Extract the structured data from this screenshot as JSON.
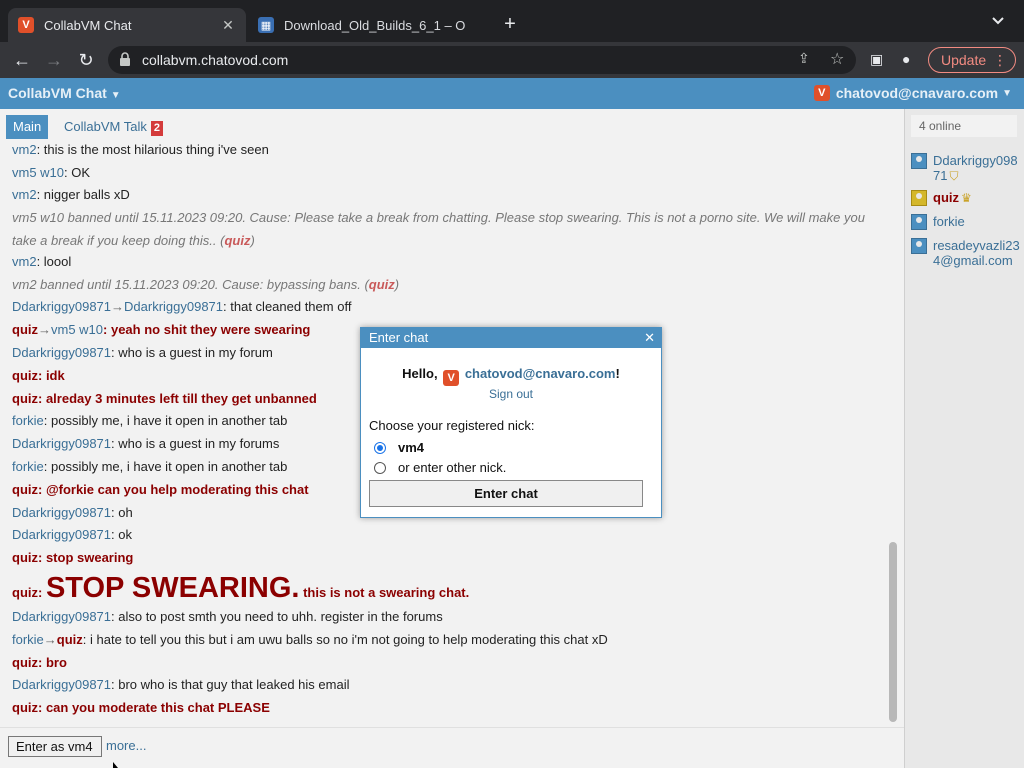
{
  "browser": {
    "tabs": [
      {
        "title": "CollabVM Chat",
        "favicon": "v-logo-icon"
      },
      {
        "title": "Download_Old_Builds_6_1 – O",
        "favicon": "document-icon"
      }
    ],
    "url": "collabvm.chatovod.com",
    "update_label": "Update"
  },
  "app": {
    "title": "CollabVM Chat",
    "user": "chatovod@cnavaro.com"
  },
  "chat_tabs": {
    "main": "Main",
    "talk": "CollabVM Talk",
    "talk_badge": "2"
  },
  "messages": [
    {
      "nick": "vm2",
      "text": ": this is the most hilarious thing i've seen"
    },
    {
      "nick": "vm5 w10",
      "text": ": OK"
    },
    {
      "nick": "vm2",
      "text": ": nigger balls xD"
    },
    {
      "text1": "vm5 w10 banned until 15.11.2023 09:20. Cause: Please take a break from chatting. Please stop swearing. This is not a porno site. We will make you take a break if you keep doing this.. (",
      "by": "quiz",
      "close": ")"
    },
    {
      "nick": "vm2",
      "text": ": loool"
    },
    {
      "text1": "vm2 banned until 15.11.2023 09:20. Cause: bypassing bans. (",
      "by": "quiz",
      "close": ")"
    },
    {
      "nick": "Ddarkriggy09871",
      "arrow": "→",
      "to": "Ddarkriggy09871",
      "text": ": that cleaned them off"
    },
    {
      "nick": "quiz",
      "arrow": "→",
      "to": "vm5 w10",
      "text": ": yeah no shit they were swearing"
    },
    {
      "nick": "Ddarkriggy09871",
      "text": ": who is a guest in my forum"
    },
    {
      "nick": "quiz",
      "text": ": idk"
    },
    {
      "nick": "quiz",
      "text": ": alreday 3 minutes left till they get unbanned"
    },
    {
      "nick": "forkie",
      "text": ": possibly me, i have it open in another tab"
    },
    {
      "nick": "Ddarkriggy09871",
      "text": ": who is a guest in my forums"
    },
    {
      "nick": "forkie",
      "text": ": possibly me, i have it open in another tab"
    },
    {
      "nick": "quiz",
      "text": ": @forkie can you help moderating this chat"
    },
    {
      "nick": "Ddarkriggy09871",
      "text": ": oh"
    },
    {
      "nick": "Ddarkriggy09871",
      "text": ": ok"
    },
    {
      "nick": "quiz",
      "text": ": stop swearing"
    },
    {
      "nick": "quiz",
      "colon": ": ",
      "big": "STOP SWEARING.",
      "text": " this is not a swearing chat."
    },
    {
      "nick": "Ddarkriggy09871",
      "text": ": also to post smth you need to uhh. register in the forums"
    },
    {
      "nick": "forkie",
      "arrow": "→",
      "to": "quiz",
      "text": ": i hate to tell you this but i am uwu balls so no i'm not going to help moderating this chat xD"
    },
    {
      "nick": "quiz",
      "text": ": bro"
    },
    {
      "nick": "Ddarkriggy09871",
      "text": ": bro who is that guy that leaked his email"
    },
    {
      "nick": "quiz",
      "text": ": can you moderate this chat PLEASE"
    }
  ],
  "bottom": {
    "enter_label": "Enter as vm4",
    "more_label": "more..."
  },
  "sidebar": {
    "online": "4 online",
    "users": [
      {
        "name": "Ddarkriggy09871"
      },
      {
        "name": "quiz"
      },
      {
        "name": "forkie"
      },
      {
        "name": "resadeyvazli234@gmail.com"
      }
    ]
  },
  "modal": {
    "title": "Enter chat",
    "hello": "Hello,",
    "email": "chatovod@cnavaro.com",
    "exclaim": "!",
    "signout": "Sign out",
    "choose": "Choose your registered nick:",
    "option1": "vm4",
    "option2": "or enter other nick.",
    "button": "Enter chat"
  }
}
